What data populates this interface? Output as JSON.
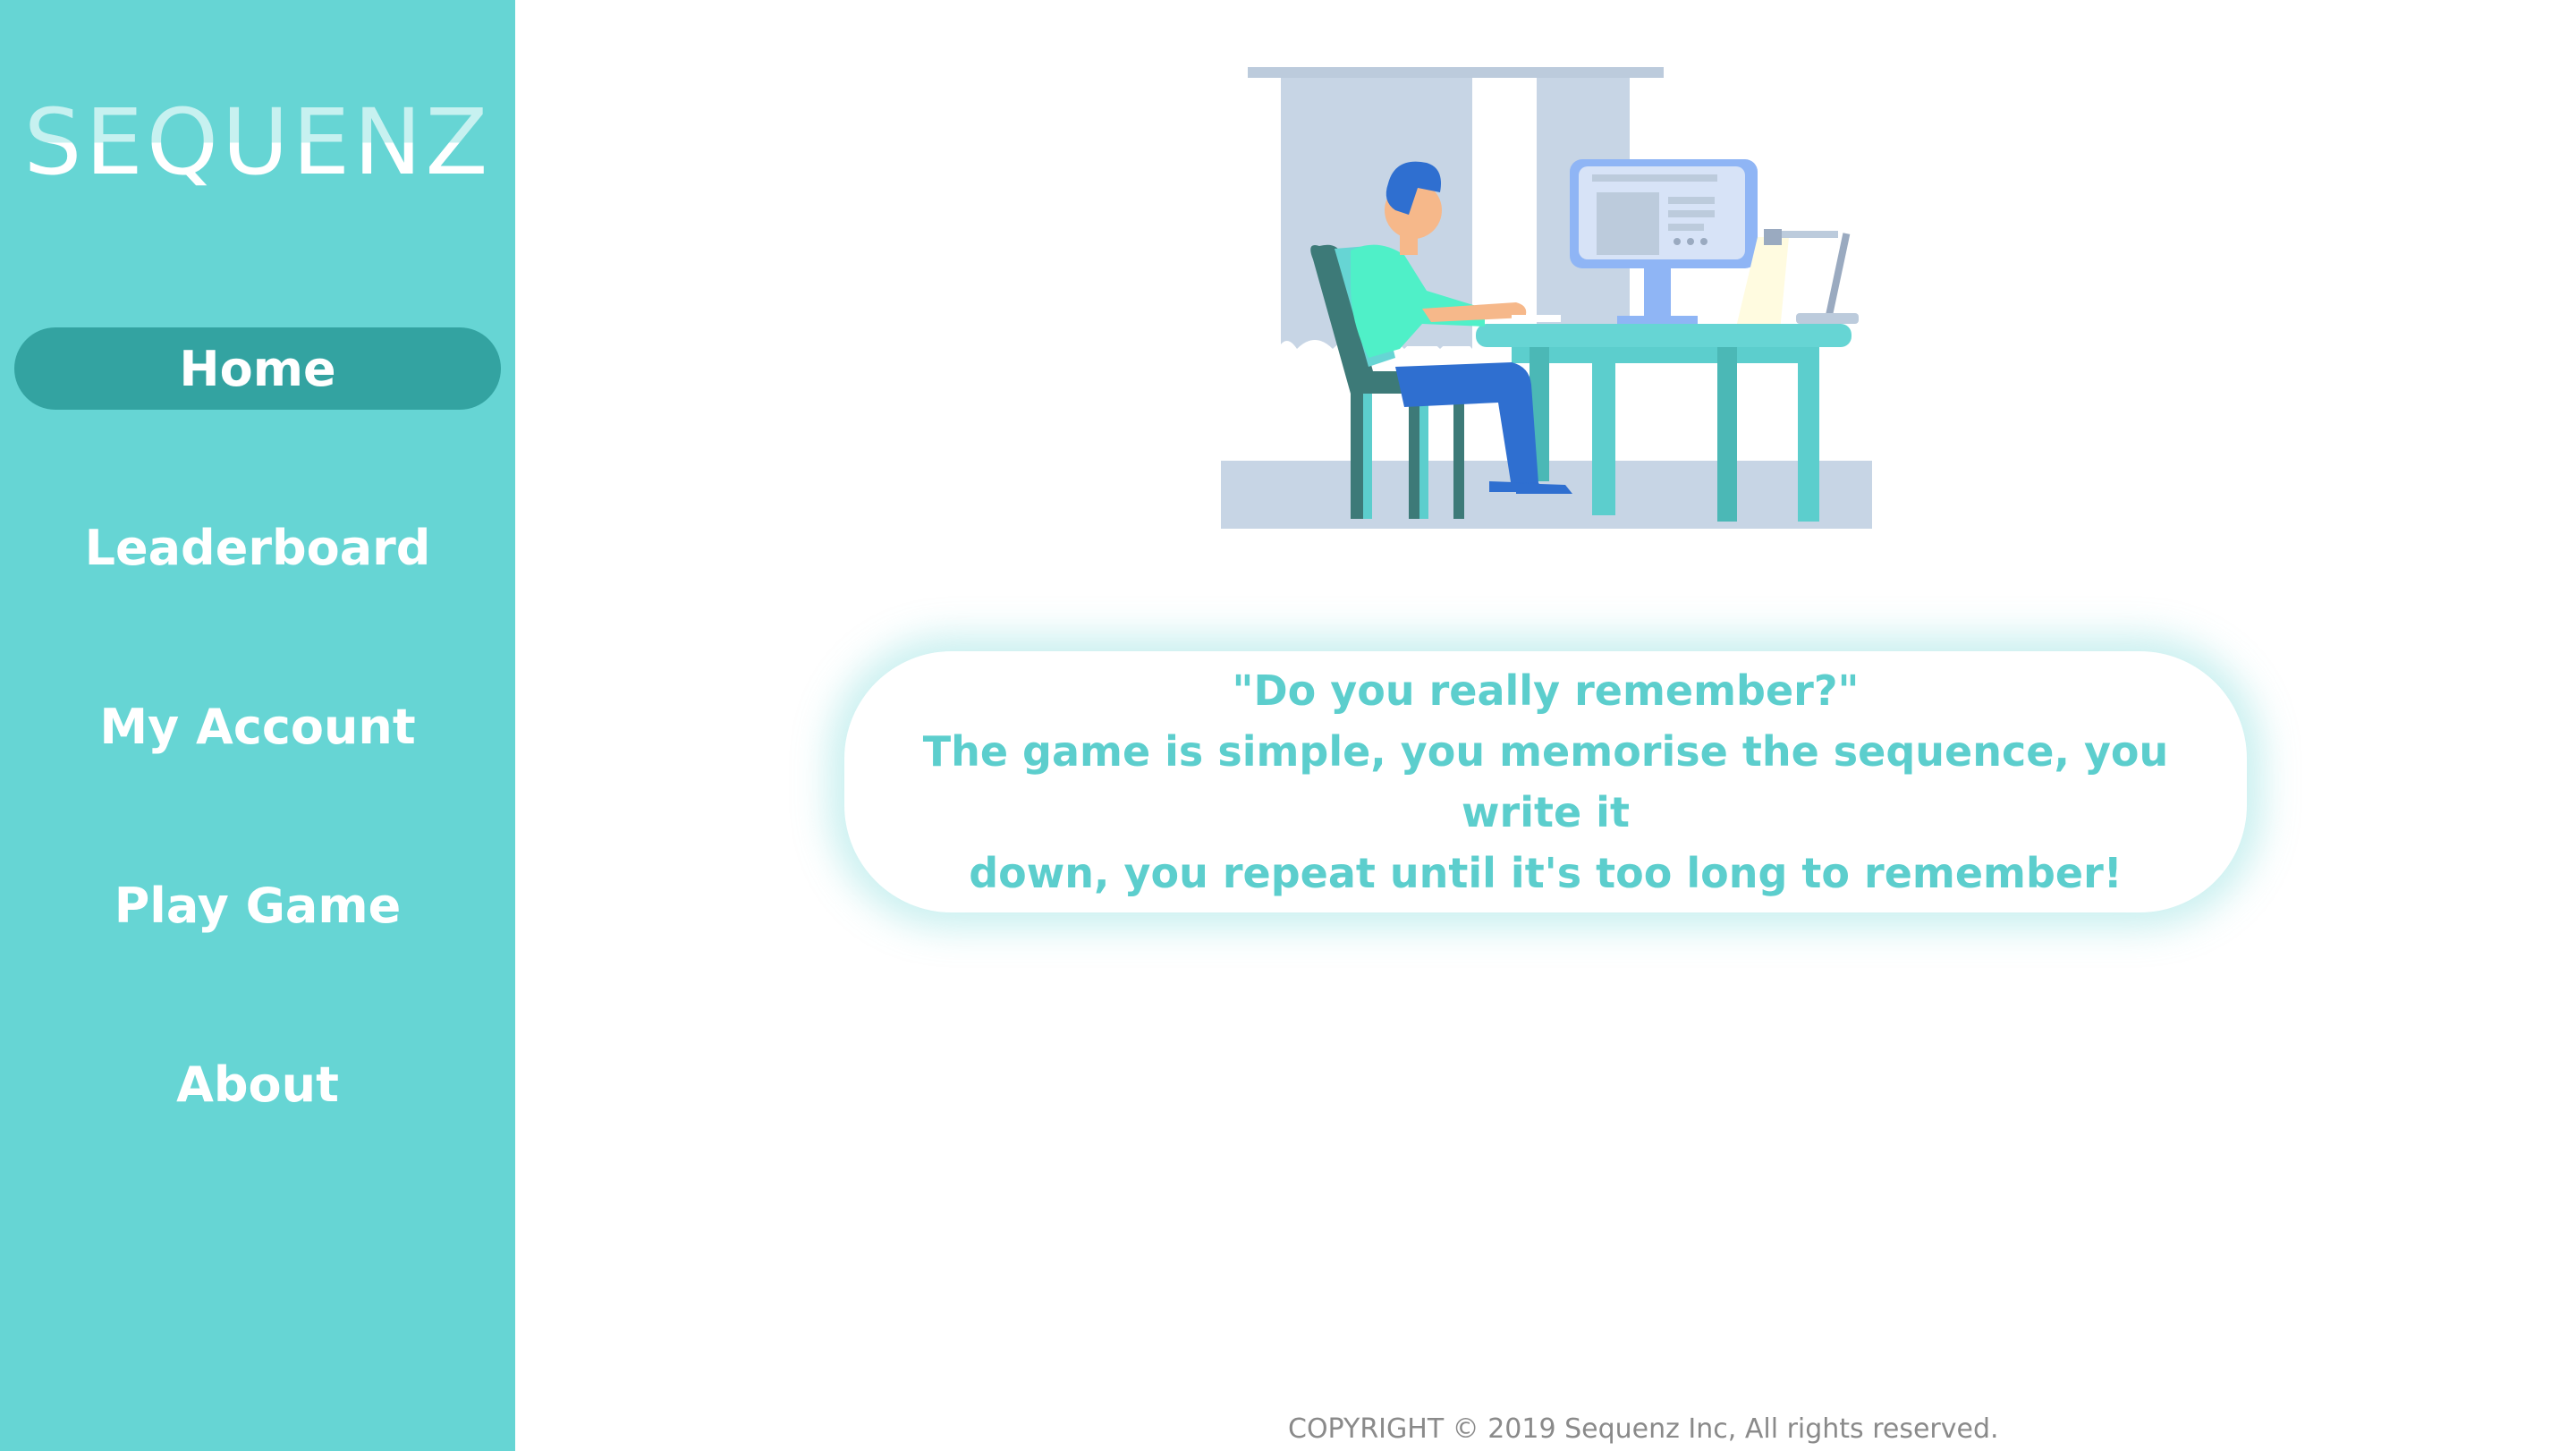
{
  "sidebar": {
    "brand": "SEQUENZ",
    "items": [
      {
        "label": "Home",
        "active": true
      },
      {
        "label": "Leaderboard",
        "active": false
      },
      {
        "label": "My Account",
        "active": false
      },
      {
        "label": "Play Game",
        "active": false
      },
      {
        "label": "About",
        "active": false
      }
    ]
  },
  "main": {
    "hero_image": "person-at-computer-desk-illustration",
    "quote": {
      "headline": "\"Do you really remember?\"",
      "line1": "The game is simple, you memorise the sequence, you write it",
      "line2": "down, you repeat until it's too long to remember!"
    }
  },
  "footer": {
    "copyright": "COPYRIGHT © 2019 Sequenz Inc, All rights reserved."
  },
  "colors": {
    "sidebar": "#66d5d4",
    "active_item": "#33a3a1",
    "accent_text": "#5ccecd"
  }
}
